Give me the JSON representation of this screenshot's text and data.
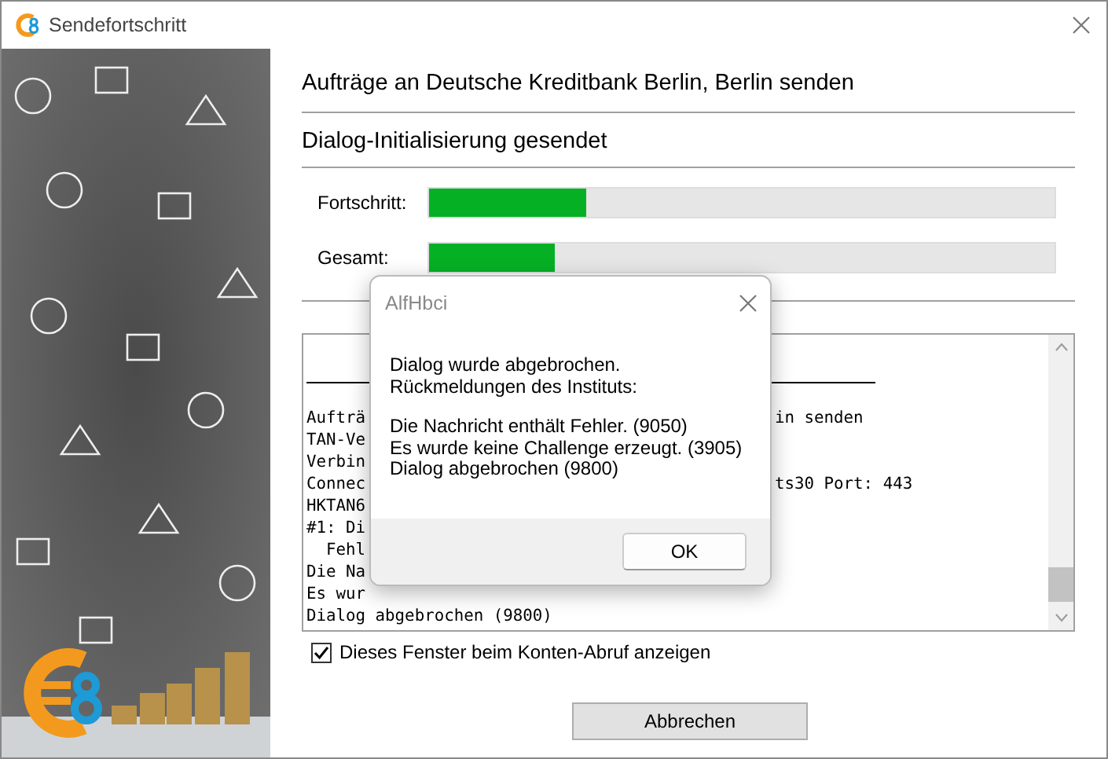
{
  "window": {
    "title": "Sendefortschritt"
  },
  "heading": "Aufträge an Deutsche Kreditbank Berlin, Berlin senden",
  "status": "Dialog-Initialisierung gesendet",
  "progress": [
    {
      "label": "Fortschritt:",
      "level": 0.25
    },
    {
      "label": "Gesamt:",
      "level": 0.2
    }
  ],
  "log": {
    "lines": [
      {
        "start": "Aufträ",
        "end": "in senden"
      },
      {
        "start": "TAN-Ve"
      },
      {
        "start": "Verbin"
      },
      {
        "start": "Connec",
        "end": "ts30 Port: 443"
      },
      {
        "start": "HKTAN6"
      },
      {
        "start": "#1: Di"
      },
      {
        "start": "  Fehl"
      },
      {
        "start": "Die Na"
      },
      {
        "start": "Es wur"
      },
      {
        "start": "Dialog abgebrochen (9800)"
      }
    ]
  },
  "show_window_checkbox": {
    "label": "Dieses Fenster beim Konten-Abruf anzeigen",
    "checked": true
  },
  "cancel_button": "Abbrechen",
  "dialog": {
    "title": "AlfHbci",
    "paragraphs": [
      "Dialog wurde abgebrochen.\nRückmeldungen des Instituts:",
      "Die Nachricht enthält Fehler. (9050)\nEs wurde keine Challenge erzeugt. (3905)\nDialog abgebrochen (9800)"
    ],
    "ok_button": "OK"
  }
}
